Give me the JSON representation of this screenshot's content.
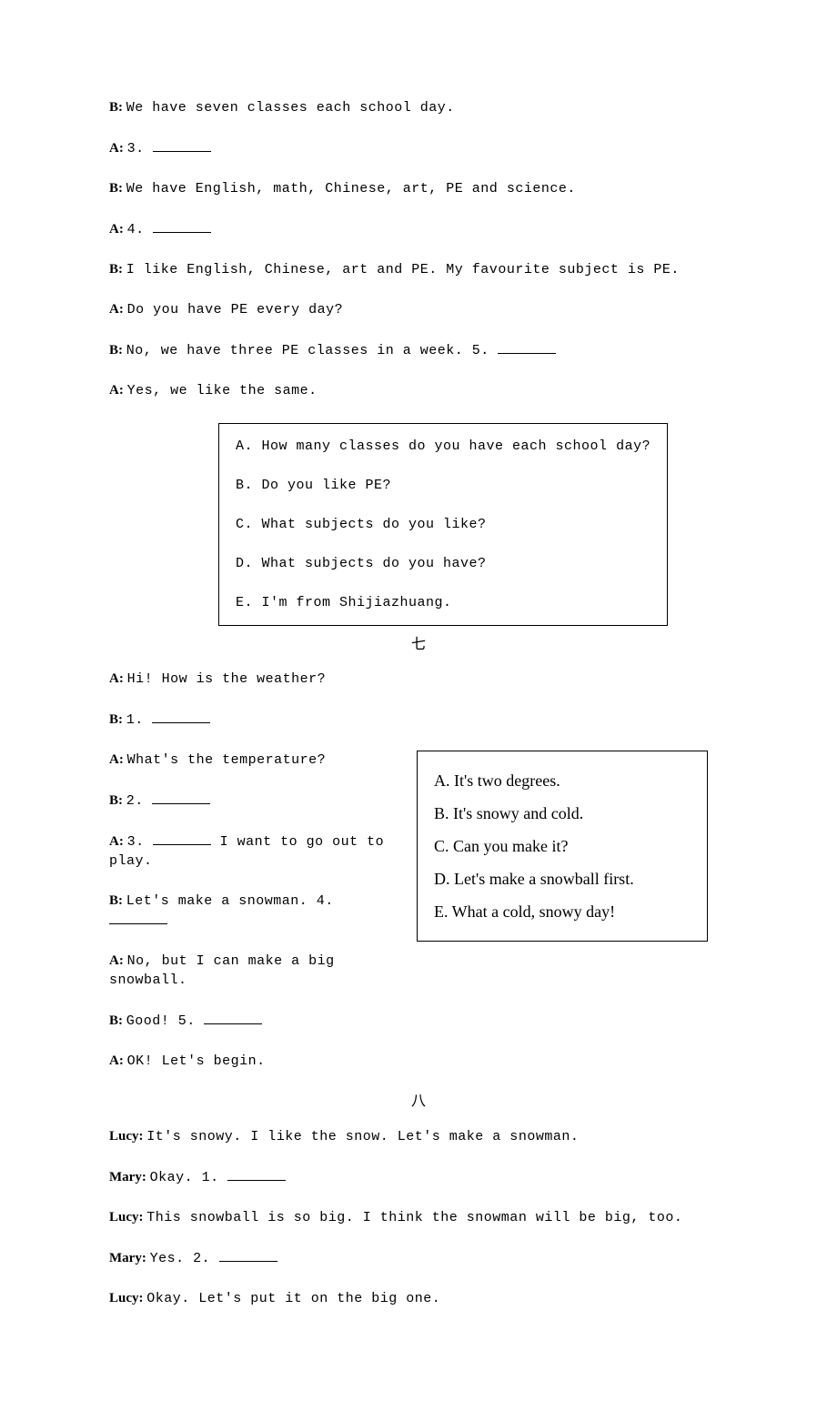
{
  "dialogue6": {
    "l1_speaker": "B:",
    "l1_text": "We have seven classes each school day.",
    "l2_speaker": "A:",
    "l2_text_before": "3. ",
    "l3_speaker": "B:",
    "l3_text": "We have English, math, Chinese, art, PE and science.",
    "l4_speaker": "A:",
    "l4_text_before": "4. ",
    "l5_speaker": "B:",
    "l5_text": "I like English, Chinese, art and PE. My favourite subject is PE.",
    "l6_speaker": "A:",
    "l6_text": "Do you have PE every day?",
    "l7_speaker": "B:",
    "l7_text_before": "No, we have three PE classes in a week. 5. ",
    "l8_speaker": "A:",
    "l8_text": "Yes, we like the same.",
    "options": {
      "a": "A. How many classes do you have each school day?",
      "b": "B. Do you like PE?",
      "c": "C. What subjects do you like?",
      "d": "D. What subjects do you have?",
      "e": "E. I'm from Shijiazhuang."
    }
  },
  "section7_title": "七",
  "dialogue7": {
    "l1_speaker": "A:",
    "l1_text": "Hi! How is the weather?",
    "l2_speaker": "B:",
    "l2_text_before": "1. ",
    "l3_speaker": "A:",
    "l3_text": "What's the temperature?",
    "l4_speaker": "B:",
    "l4_text_before": "2. ",
    "l5_speaker": "A:",
    "l5_text_before": "3. ",
    "l5_text_after": " I want to go out to play.",
    "l6_speaker": "B:",
    "l6_text_before": "Let's make a snowman. 4. ",
    "l7_speaker": "A:",
    "l7_text": "No, but I can make a big snowball.",
    "l8_speaker": "B:",
    "l8_text_before": "Good! 5. ",
    "l9_speaker": "A:",
    "l9_text": "OK! Let's begin.",
    "options": {
      "a": "A. It's two degrees.",
      "b": "B. It's snowy and cold.",
      "c": "C. Can you make it?",
      "d": "D. Let's make a snowball first.",
      "e": "E. What a cold, snowy day!"
    }
  },
  "section8_title": "八",
  "dialogue8": {
    "l1_speaker": "Lucy:",
    "l1_text": "It's snowy. I like the snow. Let's make a snowman.",
    "l2_speaker": "Mary:",
    "l2_text_before": "Okay. 1. ",
    "l3_speaker": "Lucy:",
    "l3_text": "This snowball is so big. I think the snowman will be big, too.",
    "l4_speaker": "Mary:",
    "l4_text_before": "Yes. 2. ",
    "l5_speaker": "Lucy:",
    "l5_text": "Okay. Let's put it on the big one."
  }
}
